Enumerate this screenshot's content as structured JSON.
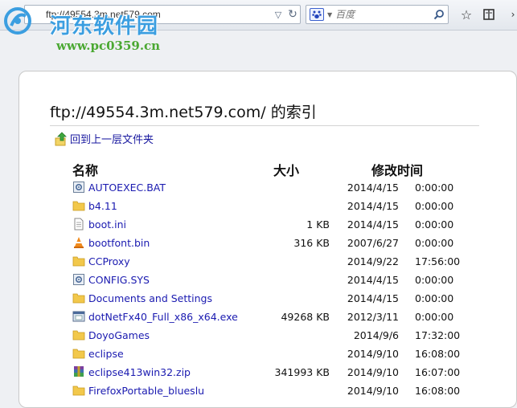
{
  "toolbar": {
    "url": "ftp://49554.3m.net579.com",
    "search_placeholder": "百度"
  },
  "watermark": {
    "title": "河东软件园",
    "url": "www.pc0359.cn"
  },
  "page": {
    "heading": "ftp://49554.3m.net579.com/ 的索引",
    "parent_link": "回到上一层文件夹",
    "columns": {
      "name": "名称",
      "size": "大小",
      "modified": "修改时间"
    }
  },
  "files": [
    {
      "name": "AUTOEXEC.BAT",
      "size": "",
      "date": "2014/4/15",
      "time": "0:00:00",
      "icon": "system-file-icon"
    },
    {
      "name": "b4.11",
      "size": "",
      "date": "2014/4/15",
      "time": "0:00:00",
      "icon": "folder-icon"
    },
    {
      "name": "boot.ini",
      "size": "1 KB",
      "date": "2014/4/15",
      "time": "0:00:00",
      "icon": "text-file-icon"
    },
    {
      "name": "bootfont.bin",
      "size": "316 KB",
      "date": "2007/6/27",
      "time": "0:00:00",
      "icon": "vlc-file-icon"
    },
    {
      "name": "CCProxy",
      "size": "",
      "date": "2014/9/22",
      "time": "17:56:00",
      "icon": "folder-icon"
    },
    {
      "name": "CONFIG.SYS",
      "size": "",
      "date": "2014/4/15",
      "time": "0:00:00",
      "icon": "system-file-icon"
    },
    {
      "name": "Documents and Settings",
      "size": "",
      "date": "2014/4/15",
      "time": "0:00:00",
      "icon": "folder-icon"
    },
    {
      "name": "dotNetFx40_Full_x86_x64.exe",
      "size": "49268 KB",
      "date": "2012/3/11",
      "time": "0:00:00",
      "icon": "exe-file-icon"
    },
    {
      "name": "DoyoGames",
      "size": "",
      "date": "2014/9/6",
      "time": "17:32:00",
      "icon": "folder-icon"
    },
    {
      "name": "eclipse",
      "size": "",
      "date": "2014/9/10",
      "time": "16:08:00",
      "icon": "folder-icon"
    },
    {
      "name": "eclipse413win32.zip",
      "size": "341993 KB",
      "date": "2014/9/10",
      "time": "16:07:00",
      "icon": "archive-file-icon"
    },
    {
      "name": "FirefoxPortable_blueslu",
      "size": "",
      "date": "2014/9/10",
      "time": "16:08:00",
      "icon": "folder-icon"
    }
  ],
  "colors": {
    "link": "#1a1ab0",
    "folder": "#f2c84b",
    "watermark_blue": "#3b9ee0",
    "watermark_green": "#4aa832"
  }
}
